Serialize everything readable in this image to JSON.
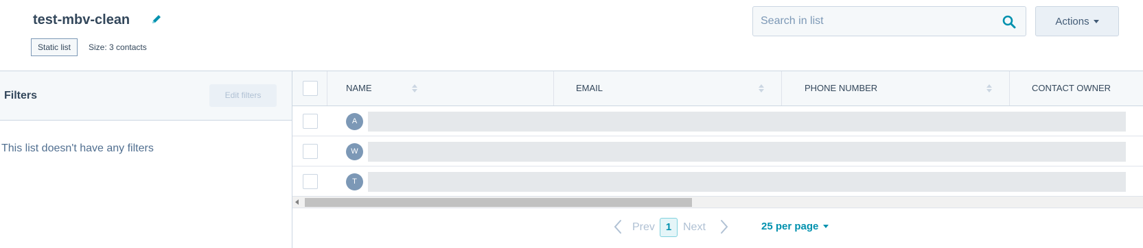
{
  "header": {
    "title": "test-mbv-clean",
    "edit_icon": "pencil-icon",
    "list_type": "Static list",
    "size_text": "Size: 3 contacts"
  },
  "search": {
    "placeholder": "Search in list",
    "value": "",
    "icon": "search-icon"
  },
  "actions": {
    "label": "Actions"
  },
  "filters": {
    "title": "Filters",
    "edit_button": "Edit filters",
    "empty_message": "This list doesn't have any filters"
  },
  "table": {
    "columns": [
      {
        "label": "NAME",
        "sortable": true
      },
      {
        "label": "EMAIL",
        "sortable": true
      },
      {
        "label": "PHONE NUMBER",
        "sortable": true
      },
      {
        "label": "CONTACT OWNER",
        "sortable": false
      }
    ],
    "rows": [
      {
        "initial": "A"
      },
      {
        "initial": "W"
      },
      {
        "initial": "T"
      }
    ]
  },
  "pagination": {
    "prev_label": "Prev",
    "current_page": "1",
    "next_label": "Next",
    "per_page_label": "25 per page"
  },
  "colors": {
    "accent": "#0091ae",
    "text": "#33475b",
    "border": "#cbd6e2",
    "avatar": "#7c98b6"
  }
}
